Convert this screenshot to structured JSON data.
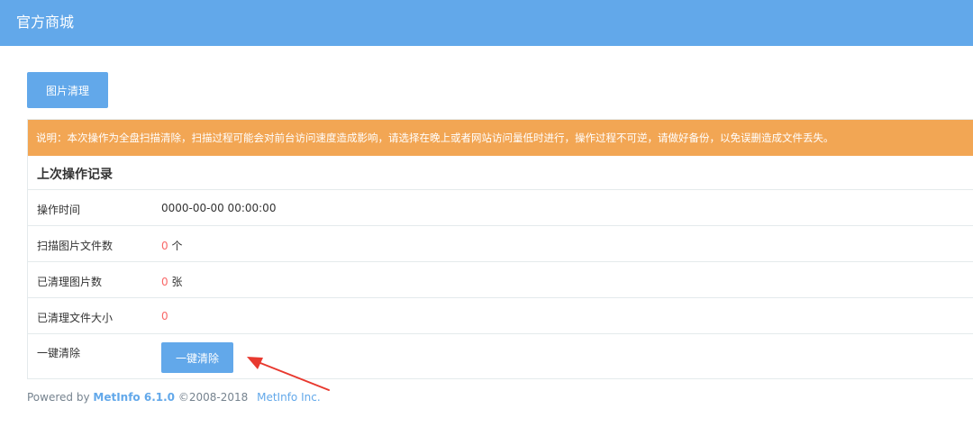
{
  "header": {
    "title": "官方商城"
  },
  "toolbar": {
    "clean_tab_label": "图片清理"
  },
  "notice": {
    "text": "说明：本次操作为全盘扫描清除，扫描过程可能会对前台访问速度造成影响，请选择在晚上或者网站访问量低时进行，操作过程不可逆，请做好备份，以免误删造成文件丢失。"
  },
  "record": {
    "title": "上次操作记录",
    "rows": [
      {
        "label": "操作时间",
        "value": "0000-00-00 00:00:00"
      },
      {
        "label": "扫描图片文件数",
        "count": "0",
        "unit": "个"
      },
      {
        "label": "已清理图片数",
        "count": "0",
        "unit": "张"
      },
      {
        "label": "已清理文件大小",
        "count": "0"
      }
    ],
    "action": {
      "label": "一键清除",
      "button": "一键清除"
    }
  },
  "footer": {
    "powered": "Powered by",
    "product": "MetInfo 6.1.0",
    "copyright": "©2008-2018",
    "company": "MetInfo Inc."
  },
  "colors": {
    "primary": "#62a8ea",
    "warning": "#f2a654",
    "danger": "#f96868",
    "arrow": "#e8392f"
  }
}
